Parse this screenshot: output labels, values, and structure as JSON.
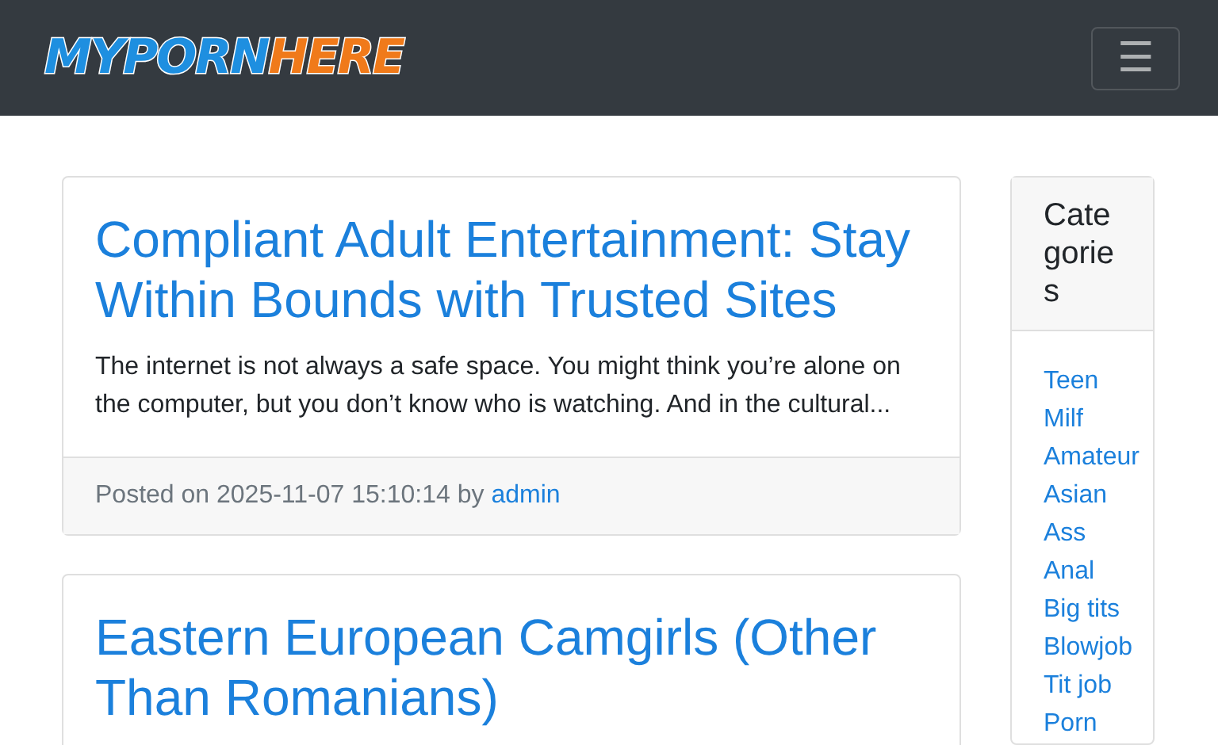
{
  "navbar": {
    "logo": [
      "MYPORN",
      "HERE"
    ],
    "menu_button": "☰"
  },
  "posts": [
    {
      "title": "Compliant Adult Entertainment: Stay Within Bounds with Trusted Sites",
      "excerpt": "The internet is not always a safe space. You might think you’re alone on the computer, but you don’t know who is watching. And in the cultural...",
      "posted": "Posted on 2025-11-07 15:10:14 by",
      "author": "admin"
    },
    {
      "title": "Eastern European Camgirls (Other Than Romanians)"
    }
  ],
  "sidebar": {
    "title": "Categories",
    "items": [
      "Teen",
      "Milf",
      "Amateur",
      "Asian",
      "Ass",
      "Anal",
      "Big tits",
      "Blowjob",
      "Tit job",
      "Porn"
    ]
  }
}
